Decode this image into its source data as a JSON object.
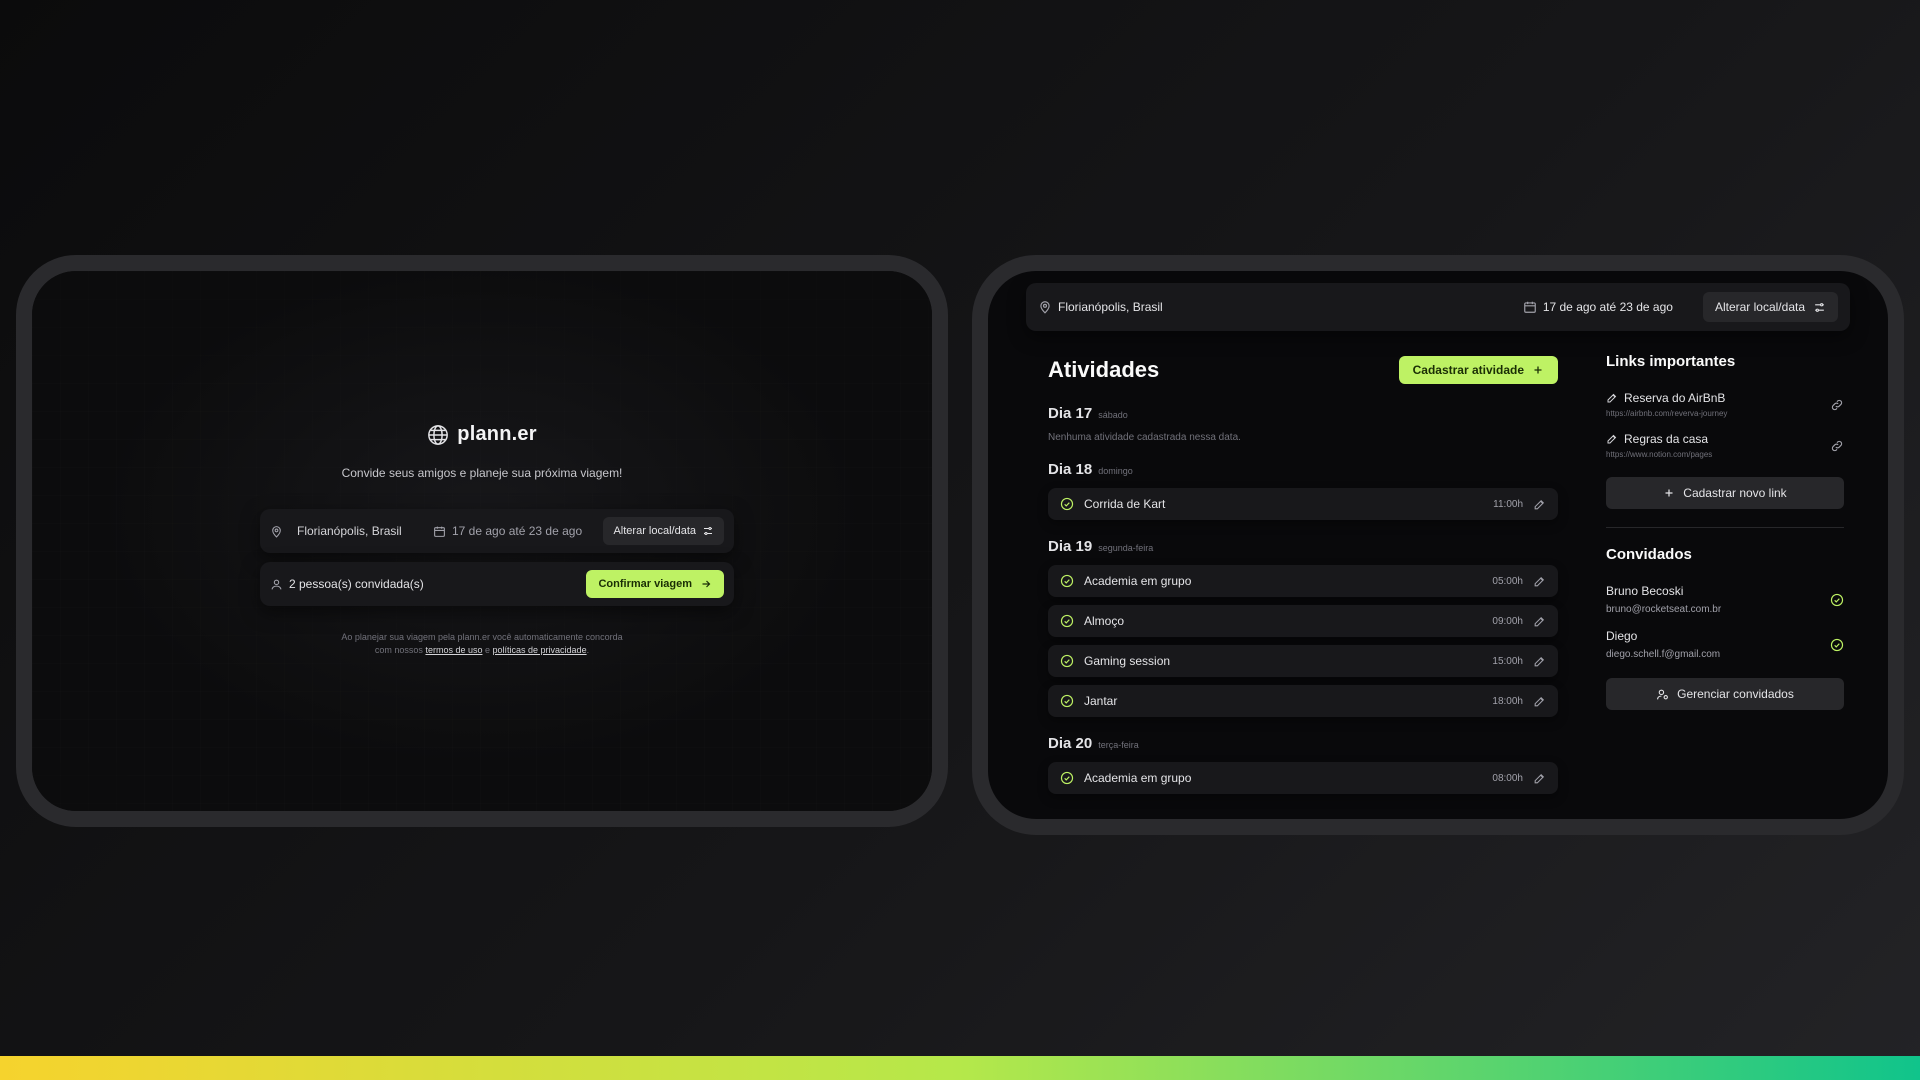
{
  "theme": {
    "accent": "#bef264",
    "background": "#0c0c0d",
    "card": "#18181b",
    "check": "#bef264"
  },
  "home": {
    "logo_text": "plann.er",
    "tagline": "Convide seus amigos e planeje sua próxima viagem!",
    "location": "Florianópolis, Brasil",
    "dates": "17 de ago até 23 de ago",
    "change_button": "Alterar local/data",
    "guests_text": "2 pessoa(s) convidada(s)",
    "confirm_button": "Confirmar viagem",
    "terms_line1": "Ao planejar sua viagem pela plann.er você automaticamente concorda",
    "terms_prefix": "com nossos",
    "terms_link": "termos de uso",
    "terms_and": "e",
    "privacy_link": "políticas de privacidade",
    "terms_end": "."
  },
  "trip": {
    "location": "Florianópolis, Brasil",
    "dates": "17 de ago até 23 de ago",
    "change_button": "Alterar local/data",
    "activities_title": "Atividades",
    "add_activity_button": "Cadastrar atividade",
    "days": [
      {
        "title": "Dia 17",
        "weekday": "sábado",
        "empty": "Nenhuma atividade cadastrada nessa data.",
        "items": []
      },
      {
        "title": "Dia 18",
        "weekday": "domingo",
        "items": [
          {
            "name": "Corrida de Kart",
            "time": "11:00h"
          }
        ]
      },
      {
        "title": "Dia 19",
        "weekday": "segunda-feira",
        "items": [
          {
            "name": "Academia em grupo",
            "time": "05:00h"
          },
          {
            "name": "Almoço",
            "time": "09:00h"
          },
          {
            "name": "Gaming session",
            "time": "15:00h"
          },
          {
            "name": "Jantar",
            "time": "18:00h"
          }
        ]
      },
      {
        "title": "Dia 20",
        "weekday": "terça-feira",
        "items": [
          {
            "name": "Academia em grupo",
            "time": "08:00h"
          }
        ]
      }
    ],
    "links_title": "Links importantes",
    "links": [
      {
        "title": "Reserva do AirBnB",
        "url": "https://airbnb.com/reverva-journey"
      },
      {
        "title": "Regras da casa",
        "url": "https://www.notion.com/pages"
      }
    ],
    "add_link_button": "Cadastrar novo link",
    "guests_title": "Convidados",
    "guests": [
      {
        "name": "Bruno Becoski",
        "email": "bruno@rocketseat.com.br"
      },
      {
        "name": "Diego",
        "email": "diego.schell.f@gmail.com"
      }
    ],
    "manage_guests_button": "Gerenciar convidados"
  },
  "icons": [
    "globe-icon",
    "map-pin-icon",
    "calendar-icon",
    "settings-sliders-icon",
    "user-icon",
    "arrow-right-icon",
    "plus-icon",
    "check-circle-icon",
    "pencil-icon",
    "link-icon",
    "user-cog-icon"
  ]
}
